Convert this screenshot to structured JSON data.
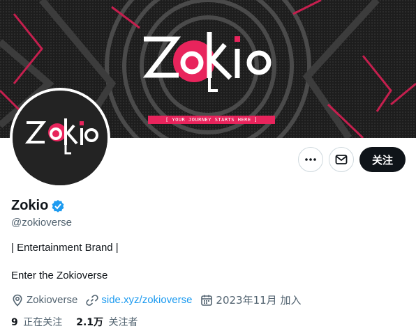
{
  "banner": {
    "logo_text": "ZoKio",
    "tagline": "[ YOUR JOURNEY STARTS HERE ]",
    "accent_color": "#e8245c"
  },
  "avatar": {
    "logo_text": "ZoKio"
  },
  "actions": {
    "more_icon": "more-horizontal-icon",
    "message_icon": "mail-icon",
    "follow_label": "关注"
  },
  "profile": {
    "display_name": "Zokio",
    "verified": true,
    "verified_color": "#1d9bf0",
    "handle": "@zokioverse",
    "bio_line1": "| Entertainment Brand |",
    "bio_line2": "Enter the Zokioverse"
  },
  "meta": {
    "location": "Zokioverse",
    "website": "side.xyz/zokioverse",
    "joined": "2023年11月 加入"
  },
  "stats": {
    "following_count": "9",
    "following_label": "正在关注",
    "followers_count": "2.1万",
    "followers_label": "关注者"
  }
}
